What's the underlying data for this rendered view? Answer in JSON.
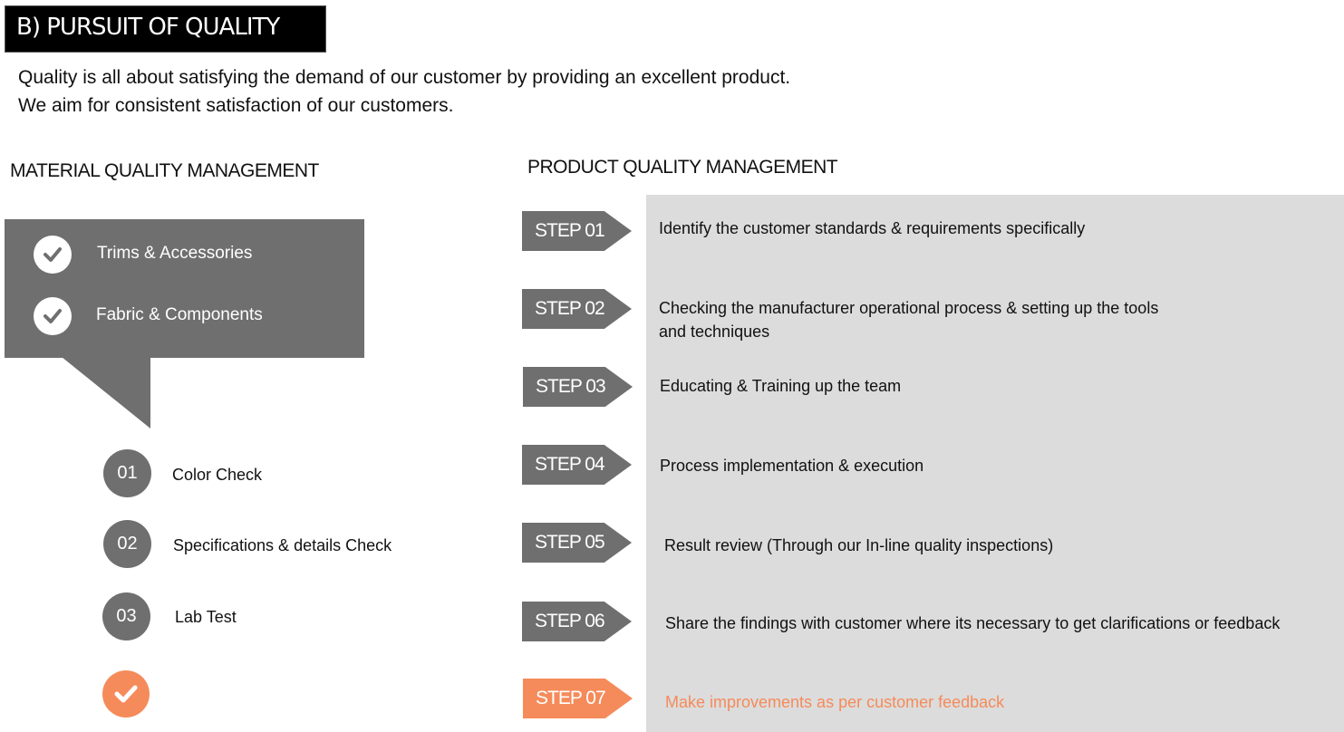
{
  "title": "B) PURSUIT OF QUALITY",
  "intro": {
    "line1": "Quality is all about satisfying the demand of our customer by providing an excellent product.",
    "line2": "We aim for consistent satisfaction of our customers."
  },
  "material": {
    "heading": "MATERIAL QUALITY MANAGEMENT",
    "callout_items": [
      "Trims & Accessories",
      "Fabric & Components"
    ],
    "checks": [
      {
        "num": "01",
        "label": "Color Check"
      },
      {
        "num": "02",
        "label": "Specifications & details Check"
      },
      {
        "num": "03",
        "label": "Lab Test"
      }
    ],
    "done_icon": "check-icon"
  },
  "product": {
    "heading": "PRODUCT QUALITY MANAGEMENT",
    "steps": [
      {
        "tag": "STEP 01",
        "text": "Identify the customer standards & requirements specifically"
      },
      {
        "tag": "STEP 02",
        "text": "Checking the manufacturer operational process & setting up the tools",
        "text2": "and techniques"
      },
      {
        "tag": "STEP 03",
        "text": "Educating & Training up the team"
      },
      {
        "tag": "STEP 04",
        "text": "Process implementation & execution"
      },
      {
        "tag": "STEP 05",
        "text": "Result review (Through our In-line quality inspections)"
      },
      {
        "tag": "STEP 06",
        "text": "Share the findings with customer where its necessary to get clarifications or feedback"
      },
      {
        "tag": "STEP 07",
        "text": "Make improvements as per customer feedback"
      }
    ]
  },
  "colors": {
    "accent": "#f58b5a",
    "gray": "#6f6f6f",
    "panel": "#dcdcdc"
  }
}
